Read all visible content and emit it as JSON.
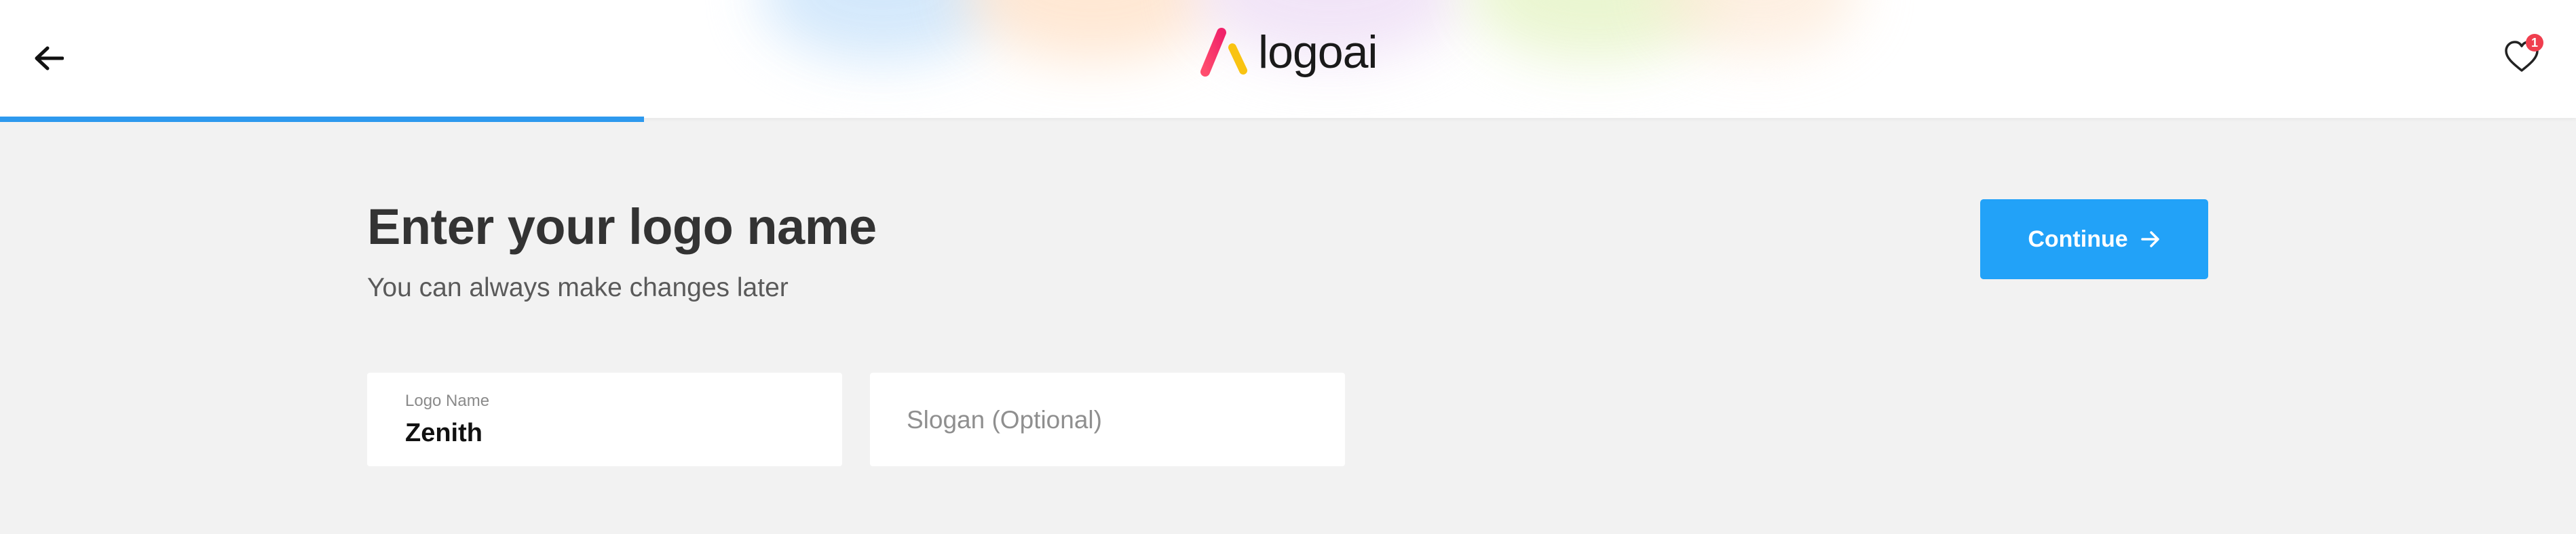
{
  "header": {
    "brand_name": "logoai",
    "favorites_count": "1",
    "progress_fraction": 0.25
  },
  "main": {
    "title": "Enter your logo name",
    "subtitle": "You can always make changes later",
    "continue_label": "Continue"
  },
  "form": {
    "logo_name_label": "Logo Name",
    "logo_name_value": "Zenith",
    "slogan_placeholder": "Slogan (Optional)",
    "slogan_value": ""
  },
  "icons": {
    "back": "arrow-left-icon",
    "favorites": "heart-icon",
    "continue": "arrow-right-icon",
    "brand": "logoai-mark-icon"
  },
  "colors": {
    "accent": "#22a2f8",
    "progress": "#2d99ee",
    "badge": "#f03e4e",
    "background": "#f2f2f2",
    "title_text": "#333333"
  }
}
